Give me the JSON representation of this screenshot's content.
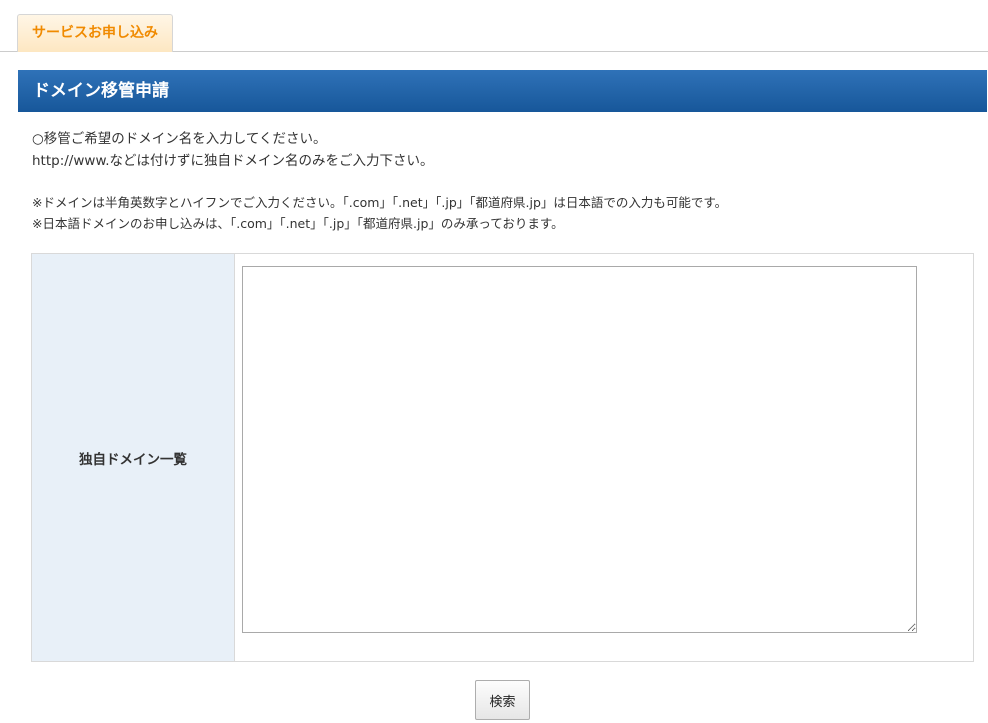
{
  "tabs": {
    "active_label": "サービスお申し込み"
  },
  "section": {
    "title": "ドメイン移管申請"
  },
  "intro": {
    "line1": "○移管ご希望のドメイン名を入力してください。",
    "line2": "http://www.などは付けずに独自ドメイン名のみをご入力下さい。"
  },
  "notes": {
    "line1": "※ドメインは半角英数字とハイフンでご入力ください。「.com」「.net」「.jp」「都道府県.jp」は日本語での入力も可能です。",
    "line2": "※日本語ドメインのお申し込みは、「.com」「.net」「.jp」「都道府県.jp」のみ承っております。"
  },
  "form": {
    "domain_list_label": "独自ドメイン一覧",
    "domain_list_value": ""
  },
  "actions": {
    "search_label": "検索"
  },
  "colors": {
    "tab_text": "#f08a00",
    "header_bg": "#1f63a8",
    "label_cell_bg": "#e8f0f8"
  }
}
